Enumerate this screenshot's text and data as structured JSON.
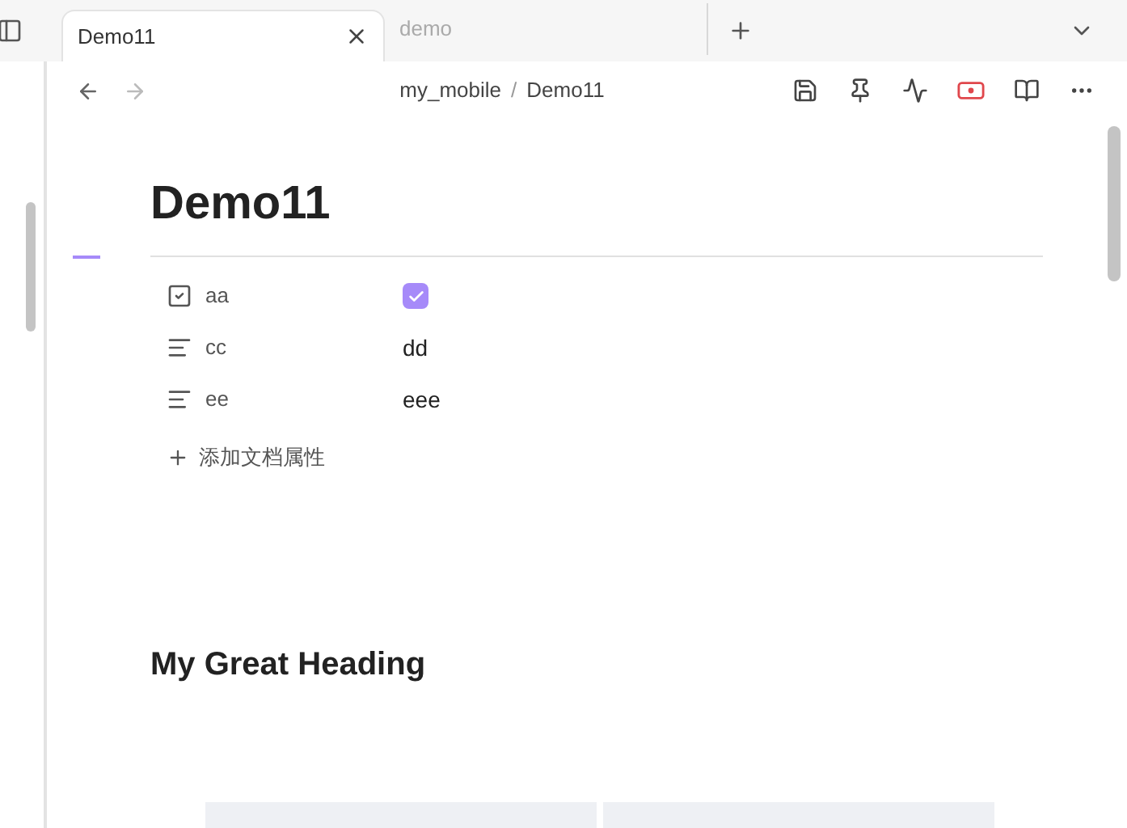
{
  "tabs": [
    {
      "label": "Demo11",
      "selected": true
    },
    {
      "label": "demo",
      "selected": false
    }
  ],
  "breadcrumb": {
    "items": [
      "my_mobile",
      "Demo11"
    ],
    "separator": "/"
  },
  "document": {
    "title": "Demo11",
    "properties": [
      {
        "kind": "checkbox",
        "name": "aa",
        "checked": true
      },
      {
        "kind": "text",
        "name": "cc",
        "value": "dd"
      },
      {
        "kind": "text",
        "name": "ee",
        "value": "eee"
      }
    ],
    "add_property": "添加文档属性",
    "heading": "My Great Heading"
  }
}
